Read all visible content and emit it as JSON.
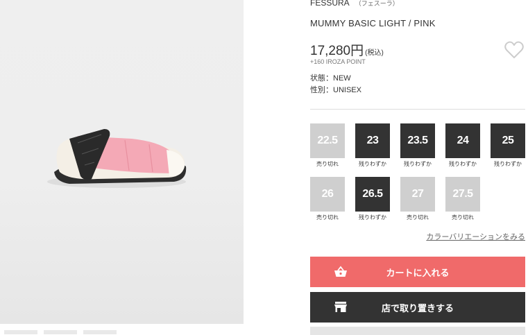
{
  "product": {
    "brand": "FESSURA",
    "brand_kana": "（フェスーラ）",
    "name": "MUMMY BASIC LIGHT / PINK",
    "price": "17,280円",
    "tax_note": "(税込)",
    "points": "+160 IROZA POINT",
    "condition": "状態：NEW",
    "gender": "性別：UNISEX",
    "favorite_icon": "heart-outline-icon"
  },
  "sizes": [
    {
      "size": "22.5",
      "status": "売り切れ"
    },
    {
      "size": "23",
      "status": "残りわずか"
    },
    {
      "size": "23.5",
      "status": "残りわずか"
    },
    {
      "size": "24",
      "status": "残りわずか"
    },
    {
      "size": "25",
      "status": "残りわずか"
    },
    {
      "size": "26",
      "status": "売り切れ"
    },
    {
      "size": "26.5",
      "status": "残りわずか"
    },
    {
      "size": "27",
      "status": "売り切れ"
    },
    {
      "size": "27.5",
      "status": "売り切れ"
    }
  ],
  "color_variation_link": "カラーバリエーションをみる",
  "buttons": {
    "cart": "カートに入れる",
    "cart_icon": "shopping-basket-icon",
    "store": "店で取り置きする",
    "store_icon": "storefront-icon"
  },
  "colors": {
    "cart_button": "#f06a6a",
    "dark_button": "#333333",
    "sold_out": "#cfcfcf"
  }
}
